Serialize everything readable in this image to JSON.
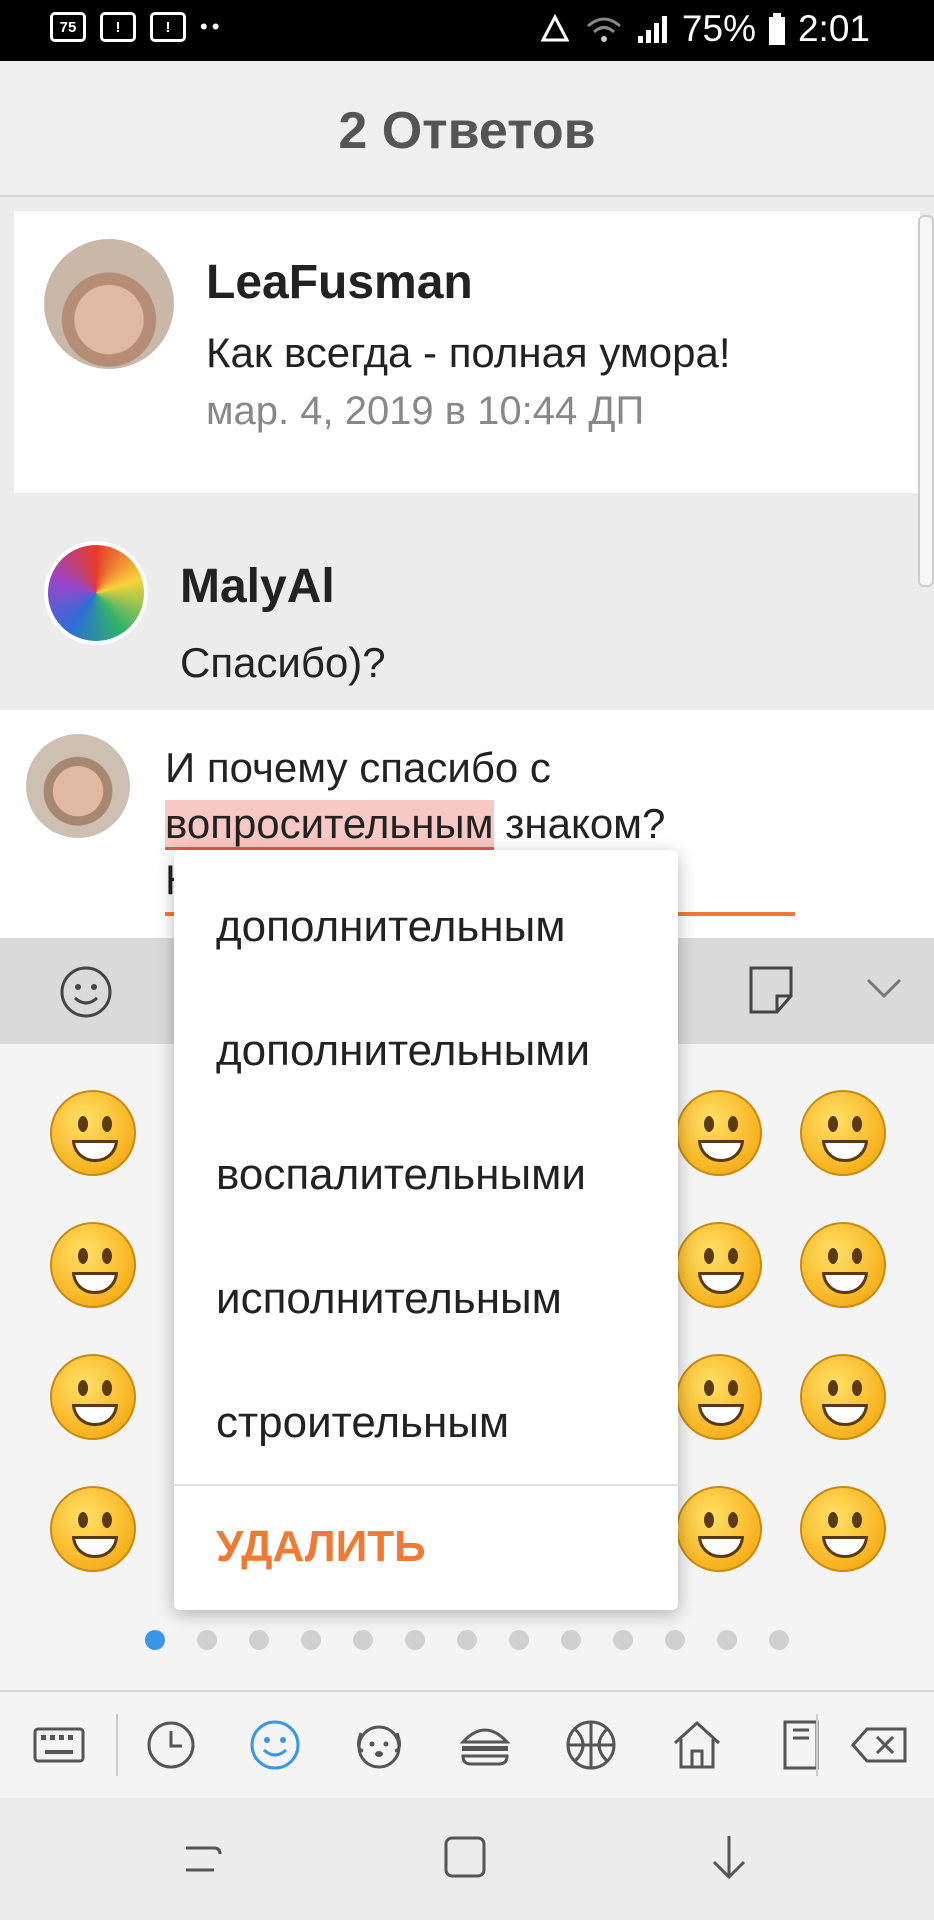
{
  "status_bar": {
    "notif_badge": "75",
    "battery": "75%",
    "time": "2:01"
  },
  "header": {
    "title": "2 Ответов"
  },
  "comments": [
    {
      "author": "LeaFusman",
      "text": "Как всегда - полная умора!",
      "date": "мар. 4, 2019 в 10:44 ДП"
    },
    {
      "author": "MalyAl",
      "text": "Спасибо)?"
    }
  ],
  "composer": {
    "line1": "И почему спасибо с",
    "misspelled_word": "вопросительным",
    "line2_rest": " знаком?",
    "line3_visible": "К",
    "send_icon": "send-icon"
  },
  "spell_suggestions": {
    "items": [
      "дополнительным",
      "дополнительными",
      "воспалительными",
      "исполнительным",
      "строительным"
    ],
    "delete_label": "УДАЛИТЬ"
  },
  "keyboard": {
    "page_dots": 13,
    "active_page": 0,
    "categories": [
      "keyboard-icon",
      "recent-clock-icon",
      "smiley-icon",
      "animal-icon",
      "food-icon",
      "sports-ball-icon",
      "house-icon",
      "objects-icon"
    ],
    "accent_color": "#3a96e8"
  },
  "colors": {
    "accent_orange": "#f07a33",
    "misspell_highlight": "#f7c8c4"
  }
}
